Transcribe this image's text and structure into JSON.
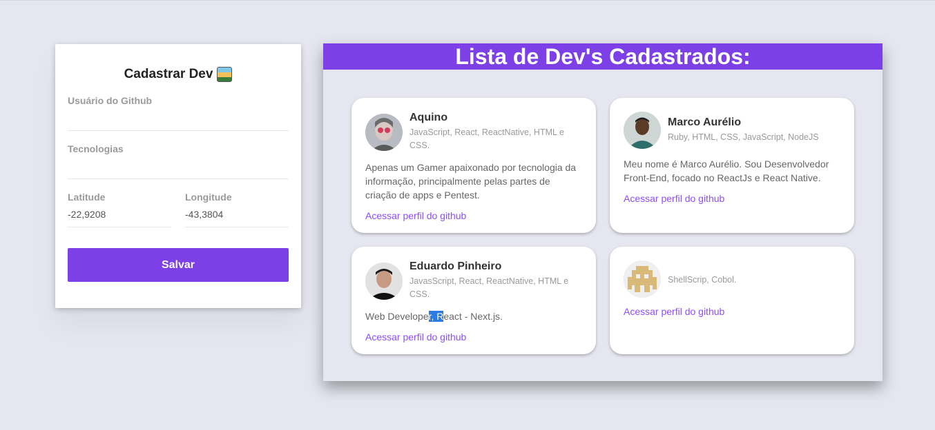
{
  "form": {
    "title": "Cadastrar Dev",
    "title_emoji": "computer-emoji",
    "github_user": {
      "label": "Usuário do Github",
      "value": ""
    },
    "techs": {
      "label": "Tecnologias",
      "value": ""
    },
    "latitude": {
      "label": "Latitude",
      "value": "-22,9208"
    },
    "longitude": {
      "label": "Longitude",
      "value": "-43,3804"
    },
    "save_label": "Salvar"
  },
  "list": {
    "title": "Lista de Dev's Cadastrados:",
    "devs": [
      {
        "name": "Aquino",
        "techs": "JavaScript, React, ReactNative, HTML e CSS.",
        "bio": "Apenas um Gamer apaixonado por tecnologia da informação, principalmente pelas partes de criação de apps e Pentest.",
        "link": "Acessar perfil do github"
      },
      {
        "name": "Marco Aurélio",
        "techs": "Ruby, HTML, CSS, JavaScript, NodeJS",
        "bio": "Meu nome é Marco Aurélio. Sou Desenvolvedor Front-End, focado no ReactJs e React Native.",
        "link": "Acessar perfil do github"
      },
      {
        "name": "Eduardo Pinheiro",
        "techs": "JavasScript, React, ReactNative, HTML e CSS.",
        "bio_before": "Web Develope",
        "bio_selected": "r, R",
        "bio_after": "eact - Next.js.",
        "link": "Acessar perfil do github"
      },
      {
        "name": "",
        "techs": "ShellScrip, Cobol.",
        "bio": "",
        "link": "Acessar perfil do github"
      }
    ]
  },
  "colors": {
    "accent": "#7d40e7",
    "link": "#8e4dff",
    "background": "#e6e6f0"
  }
}
